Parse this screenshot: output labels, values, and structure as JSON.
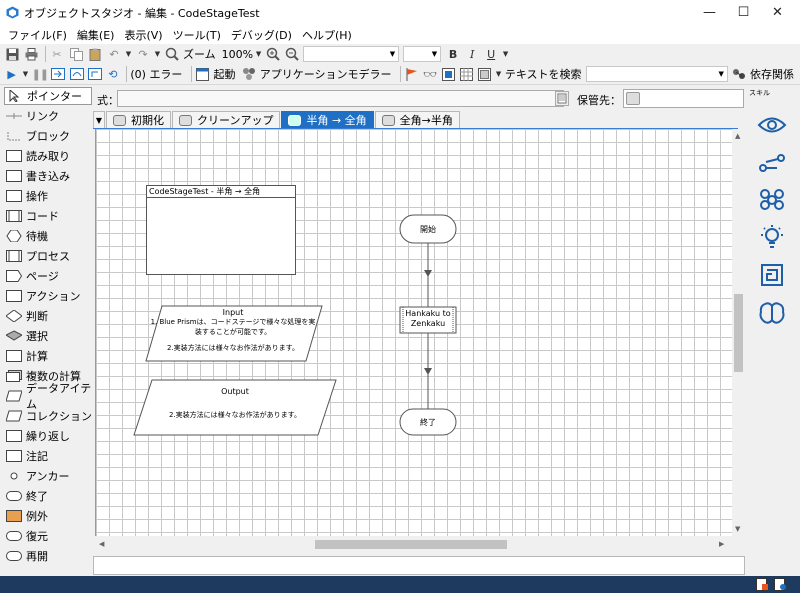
{
  "window": {
    "title": "オブジェクトスタジオ - 編集 - CodeStageTest",
    "minimize": "—",
    "maximize": "☐",
    "close": "✕"
  },
  "menu": {
    "items": [
      "ファイル(F)",
      "編集(E)",
      "表示(V)",
      "ツール(T)",
      "デバッグ(D)",
      "ヘルプ(H)"
    ]
  },
  "toolbar1": {
    "zoom_label": "ズーム",
    "zoom_value": "100%",
    "font_combo": "",
    "size_combo": "",
    "bold": "B",
    "italic": "I",
    "underline": "U"
  },
  "toolbar2": {
    "errors": "(0) エラー",
    "launch": "起動",
    "app_modeler": "アプリケーションモデラー",
    "search_text": "テキストを検索",
    "search_value": "",
    "dependencies": "依存関係"
  },
  "palette": {
    "items": [
      {
        "label": "ポインター",
        "icon": "pointer-icon"
      },
      {
        "label": "リンク",
        "icon": "link-icon"
      },
      {
        "label": "ブロック",
        "icon": "block-icon"
      },
      {
        "label": "読み取り",
        "icon": "read-icon"
      },
      {
        "label": "書き込み",
        "icon": "write-icon"
      },
      {
        "label": "操作",
        "icon": "navigate-icon"
      },
      {
        "label": "コード",
        "icon": "code-icon"
      },
      {
        "label": "待機",
        "icon": "wait-icon"
      },
      {
        "label": "プロセス",
        "icon": "process-icon"
      },
      {
        "label": "ページ",
        "icon": "page-icon"
      },
      {
        "label": "アクション",
        "icon": "action-icon"
      },
      {
        "label": "判断",
        "icon": "decision-icon"
      },
      {
        "label": "選択",
        "icon": "choice-icon"
      },
      {
        "label": "計算",
        "icon": "calculation-icon"
      },
      {
        "label": "複数の計算",
        "icon": "multi-calc-icon"
      },
      {
        "label": "データアイテム",
        "icon": "data-item-icon"
      },
      {
        "label": "コレクション",
        "icon": "collection-icon"
      },
      {
        "label": "繰り返し",
        "icon": "loop-icon"
      },
      {
        "label": "注記",
        "icon": "note-icon"
      },
      {
        "label": "アンカー",
        "icon": "anchor-icon"
      },
      {
        "label": "終了",
        "icon": "end-icon"
      },
      {
        "label": "例外",
        "icon": "exception-icon"
      },
      {
        "label": "復元",
        "icon": "recover-icon"
      },
      {
        "label": "再開",
        "icon": "resume-icon"
      }
    ]
  },
  "expression": {
    "label": "式：",
    "value": "",
    "store_label": "保管先：",
    "store_value": ""
  },
  "skill_label": "スキル",
  "tabs": [
    {
      "label": "初期化",
      "active": false
    },
    {
      "label": "クリーンアップ",
      "active": false
    },
    {
      "label": "半角 → 全角",
      "active": true
    },
    {
      "label": "全角→半角",
      "active": false
    }
  ],
  "diagram": {
    "block_title": "CodeStageTest - 半角 → 全角",
    "input_title": "Input",
    "input_line1": "1. Blue Prismは、コードステージで様々な処理を実",
    "input_line2": "装することが可能です。",
    "input_line3": "2.実装方法には様々なお作法があります。",
    "output_title": "Output",
    "output_line1": "2.実装方法には様々なお作法があります。",
    "start_label": "開始",
    "code_label_1": "Hankaku to",
    "code_label_2": "Zenkaku",
    "end_label": "終了"
  },
  "colors": {
    "active_tab": "#1f6fc5",
    "right_icons": "#1f5fa8",
    "bottom_bar": "#1e3a5f"
  }
}
